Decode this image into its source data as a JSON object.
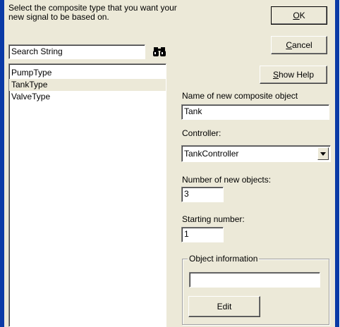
{
  "instructions": "Select the composite type that you want your new signal to be based on.",
  "search": {
    "value": "Search String",
    "icon": "binoculars-icon"
  },
  "types": [
    {
      "label": "PumpType",
      "selected": false
    },
    {
      "label": "TankType",
      "selected": true
    },
    {
      "label": "ValveType",
      "selected": false
    }
  ],
  "buttons": {
    "ok": {
      "accel": "O",
      "rest": "K"
    },
    "cancel": {
      "accel": "C",
      "rest": "ancel"
    },
    "help": {
      "accel": "S",
      "rest": "how Help"
    },
    "edit": "Edit"
  },
  "name_label": "Name of new composite object",
  "name_value": "Tank",
  "controller_label": "Controller:",
  "controller_value": "TankController",
  "count_label": "Number of new objects:",
  "count_value": "3",
  "start_label": "Starting number:",
  "start_value": "1",
  "object_info": {
    "title": "Object information",
    "value": ""
  },
  "colors": {
    "dialog_bg": "#ece9d8",
    "window_frame": "#0a3aa6"
  }
}
